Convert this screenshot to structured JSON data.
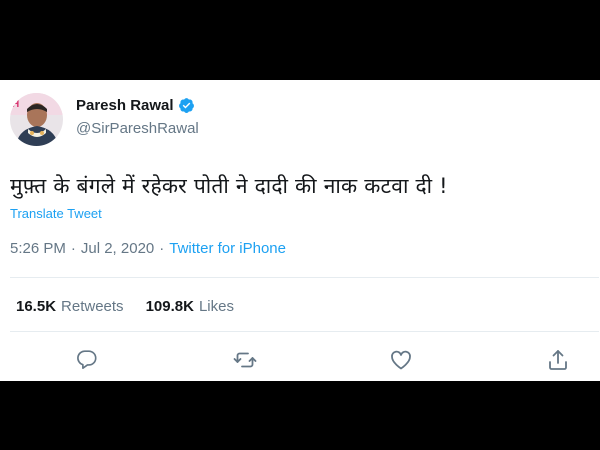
{
  "tweet": {
    "author_name": "Paresh Rawal",
    "handle": "@SirPareshRawal",
    "text": "मुफ़्त के बंगले में रहेकर पोती ने दादी की नाक कटवा दी  !",
    "translate_label": "Translate Tweet",
    "time": "5:26 PM",
    "date": "Jul 2, 2020",
    "separator": "·",
    "source": "Twitter for iPhone",
    "retweets_count": "16.5K",
    "retweets_label": "Retweets",
    "likes_count": "109.8K",
    "likes_label": "Likes"
  },
  "icons": {
    "verified": "verified-badge-icon",
    "reply": "reply-icon",
    "retweet": "retweet-icon",
    "like": "heart-icon",
    "share": "share-icon"
  },
  "colors": {
    "accent": "#1da1f2",
    "secondary_text": "#657786",
    "primary_text": "#14171a",
    "divider": "#e6ecf0"
  }
}
